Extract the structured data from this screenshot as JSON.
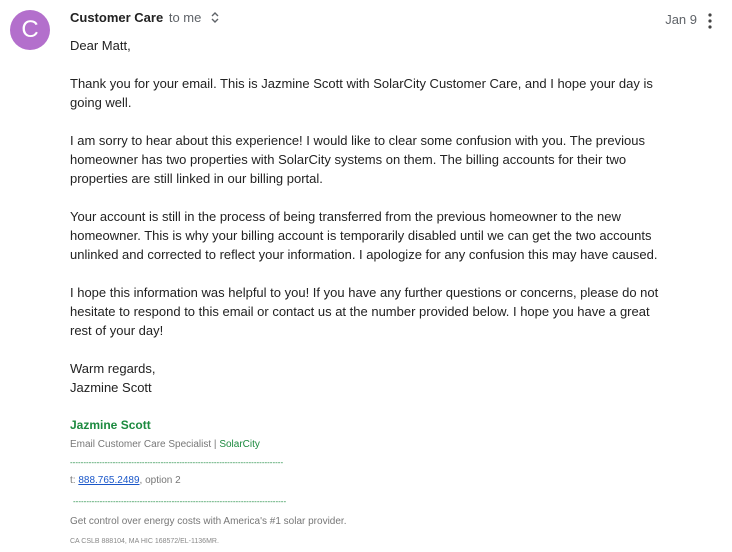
{
  "avatar": {
    "letter": "C",
    "color": "#b36fcc"
  },
  "header": {
    "sender": "Customer Care",
    "recipient": "to me",
    "date": "Jan 9",
    "icons": [
      "expand-details-icon",
      "more-vert-icon"
    ]
  },
  "body": {
    "greeting": "Dear Matt,",
    "paragraphs": [
      "Thank you for your email. This is Jazmine Scott with SolarCity Customer Care, and I hope your day is going well.",
      "I am sorry to hear about this experience! I would like to clear some confusion with you. The previous homeowner has two properties with SolarCity systems on them. The billing accounts for their two properties are still linked in our billing portal.",
      "Your account is still in the process of being transferred from the previous homeowner to the new homeowner. This is why your billing account is temporarily disabled until we can get the two accounts unlinked and corrected to reflect your information. I apologize for any confusion this may have caused.",
      "I hope this information was helpful to you! If you have any further questions or concerns, please do not hesitate to respond to this email or contact us at the number provided below. I hope you have a great rest of your day!"
    ],
    "closing": "Warm regards,",
    "closing_name": "Jazmine Scott"
  },
  "signature": {
    "name": "Jazmine Scott",
    "title": "Email Customer Care Specialist | ",
    "company": "SolarCity",
    "divider": "--------------------------------------------------------------------------------",
    "phone_prefix": "t: ",
    "phone": "888.765.2489",
    "phone_suffix": ", option 2",
    "tagline": "Get control over energy costs with America's #1 solar provider.",
    "license": "CA CSLB 888104, MA HIC 168572/EL-1136MR.",
    "accent_color": "#1c8a3f"
  }
}
